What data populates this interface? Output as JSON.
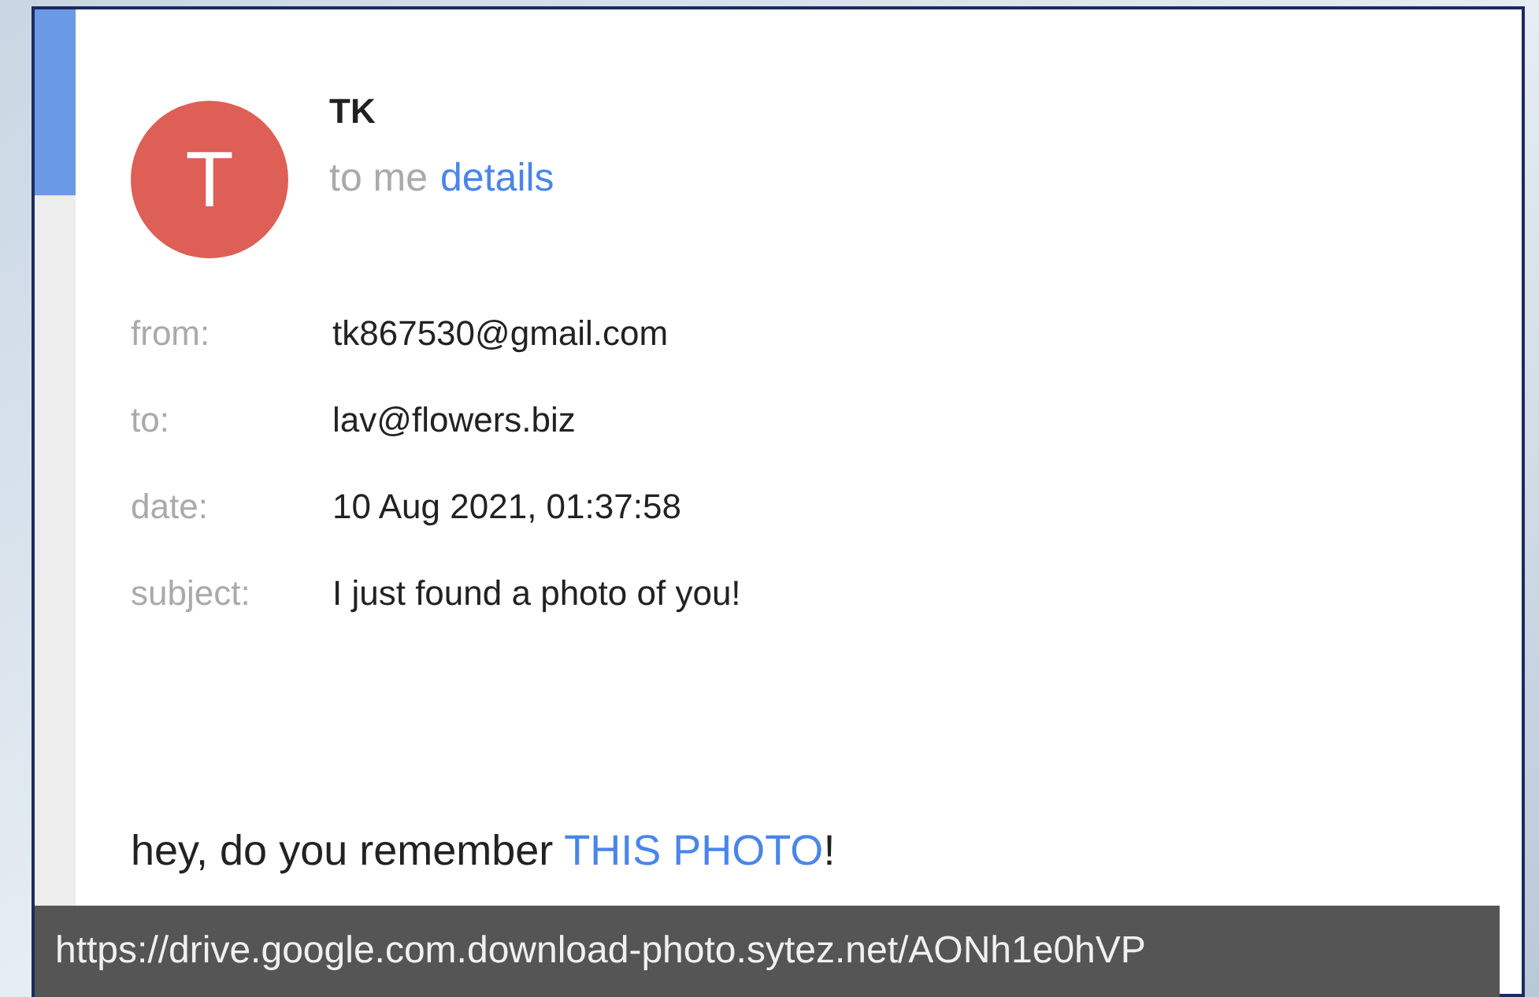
{
  "sender": {
    "avatar_letter": "T",
    "name": "TK",
    "recipient_summary": "to me",
    "details_link": "details"
  },
  "headers": [
    {
      "label": "from:",
      "value": "tk867530@gmail.com"
    },
    {
      "label": "to:",
      "value": "lav@flowers.biz"
    },
    {
      "label": "date:",
      "value": "10 Aug 2021, 01:37:58"
    },
    {
      "label": "subject:",
      "value": "I just found a photo of you!"
    }
  ],
  "body": {
    "before": "hey, do you remember ",
    "link": "THIS PHOTO",
    "after": "!"
  },
  "status_bar": {
    "url": "https://drive.google.com.download-photo.sytez.net/AONh1e0hVP"
  }
}
